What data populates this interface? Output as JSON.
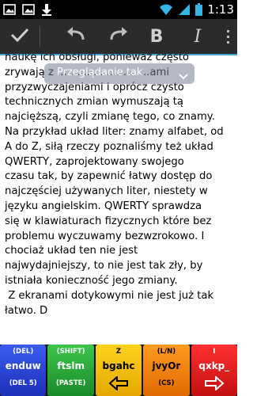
{
  "status_bar": {
    "time": "1:13",
    "left_icons": [
      "image-icon",
      "image-icon",
      "download-icon"
    ],
    "right_icons": [
      "wifi-icon",
      "signal-icon",
      "battery-icon"
    ]
  },
  "toolbar": {
    "accent_color": "#3fa6d6",
    "done_icon": "check-icon",
    "undo_icon": "undo-icon",
    "redo_icon": "redo-icon",
    "bold_label": "B",
    "italic_label": "I",
    "overflow_icon": "overflow-menu-icon"
  },
  "preview": {
    "label": "Przeglądanie tak"
  },
  "document": {
    "text": "naukę ich obsługi, ponieważ często\nzrywają z ............................ami\nprzyzwyczajeniami i oprócz czysto\ntechnicznych zmian wymuszają tą\nnajcięższą, czyli zmianę tego, co znamy.\nNa przykład układ liter: znamy alfabet, od\nA do Z, siłą rzeczy poznaliśmy też układ\nQWERTY, zaprojektowany swojego\nczasu tak, by zapewnić łatwy dostęp do\nnajczęściej używanych liter, niestety w\njęzyku angielskim. QWERTY sprawdza\nsię w klawiaturach fizycznych które bez\nproblemu wyczuwamy bezwzrokowo. I\nchociaż układ ten nie jest\nnajwydajniejszy, to nie jest tak zły, by\nistniała konieczność jego zmiany.\n Z ekranami dotykowymi nie jest już tak\nłatwo. D"
  },
  "keyboard": {
    "keys": [
      {
        "top": "(DEL)",
        "mid": "enduw",
        "bot": "(DEL 5)",
        "color": "#2a44d8"
      },
      {
        "top": "(SHIFT)",
        "mid": "ftslm",
        "bot": "(PASTE)",
        "color": "#2aa63a"
      },
      {
        "top": "Z",
        "mid": "bgahc",
        "bot": "",
        "arrow": "left-arrow-icon",
        "color": "#f5bd10"
      },
      {
        "top": "(L/N)",
        "mid": "jvyOr",
        "bot": "(CS)",
        "color": "#f58210"
      },
      {
        "top": "I",
        "mid": "qxkp_",
        "bot": "",
        "arrow": "right-arrow-icon",
        "color": "#e02020"
      }
    ]
  }
}
